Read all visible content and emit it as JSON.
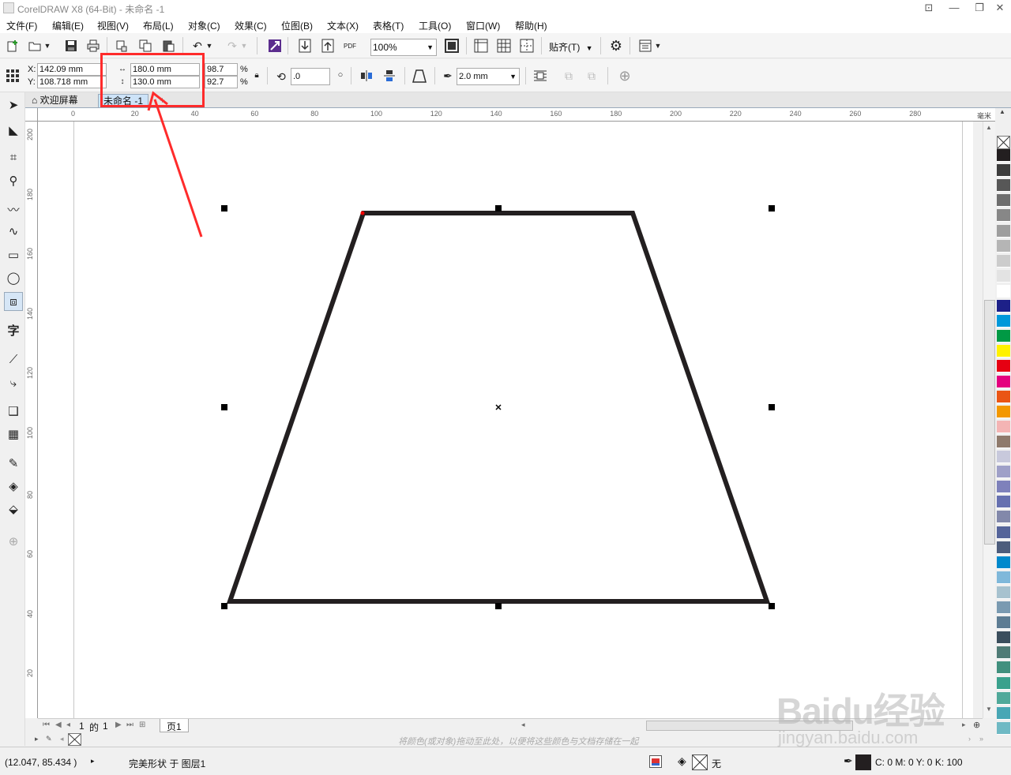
{
  "window": {
    "title": "CorelDRAW X8 (64-Bit) - 未命名 -1",
    "controls": [
      "minimize",
      "restore",
      "close"
    ]
  },
  "menu": [
    "文件(F)",
    "编辑(E)",
    "视图(V)",
    "布局(L)",
    "对象(C)",
    "效果(C)",
    "位图(B)",
    "文本(X)",
    "表格(T)",
    "工具(O)",
    "窗口(W)",
    "帮助(H)"
  ],
  "toolbar": {
    "zoom_value": "100%",
    "snap_label": "贴齐(T)",
    "pdf_label": "PDF"
  },
  "property_bar": {
    "x_label": "X:",
    "y_label": "Y:",
    "x_value": "142.09 mm",
    "y_value": "108.718 mm",
    "width_value": "180.0 mm",
    "height_value": "130.0 mm",
    "scale_x": "98.7",
    "scale_y": "92.7",
    "percent": "%",
    "rotation": ".0",
    "outline_width": "2.0 mm"
  },
  "doc_tabs": [
    {
      "label": "欢迎屏幕",
      "active": false
    },
    {
      "label": "未命名 -1",
      "active": true
    }
  ],
  "rulers": {
    "unit": "毫米",
    "h_ticks": [
      "0",
      "20",
      "40",
      "60",
      "80",
      "100",
      "120",
      "140",
      "160",
      "180",
      "200",
      "220",
      "240",
      "260",
      "280"
    ],
    "v_ticks": [
      "200",
      "180",
      "160",
      "140",
      "120",
      "100",
      "80",
      "60",
      "40",
      "20"
    ]
  },
  "pages": {
    "current": "1",
    "of_label": "的",
    "total": "1",
    "page_tab": "页1"
  },
  "colorbar_hint": "将颜色(或对象)拖动至此处，以便将这些颜色与文档存储在一起",
  "status": {
    "coords": "(12.047, 85.434 )",
    "object_info": "完美形状 于 图层1",
    "fill": "无",
    "outline_color": "C: 0 M: 0 Y: 0 K: 100"
  },
  "palette_colors": [
    "#231f20",
    "#3c3c3c",
    "#575757",
    "#6e6e6e",
    "#878787",
    "#9e9e9e",
    "#b5b5b5",
    "#cccccc",
    "#e3e3e3",
    "#ffffff",
    "#1d2088",
    "#0098da",
    "#009944",
    "#fff100",
    "#e60012",
    "#e4007f",
    "#ea5514",
    "#f39800",
    "#f4b4b4",
    "#8f7a6c",
    "#c8c9dc",
    "#9fa0c8",
    "#7e81bb",
    "#6670b0",
    "#8288aa",
    "#55649a",
    "#4d5d7c",
    "#0089cc",
    "#7fb8da",
    "#a7c2cf",
    "#7a9ab1",
    "#5d7c93",
    "#3b4e5d",
    "#4f7b76",
    "#41907e",
    "#3aa18d",
    "#50a99a",
    "#48a7b5",
    "#6fb9c4"
  ],
  "watermark": {
    "brand": "Baidu经验",
    "url": "jingyan.baidu.com"
  },
  "colors": {
    "shape_outline": "#231f20",
    "annotation": "#ff2b2b",
    "selection_handle": "#000000"
  }
}
